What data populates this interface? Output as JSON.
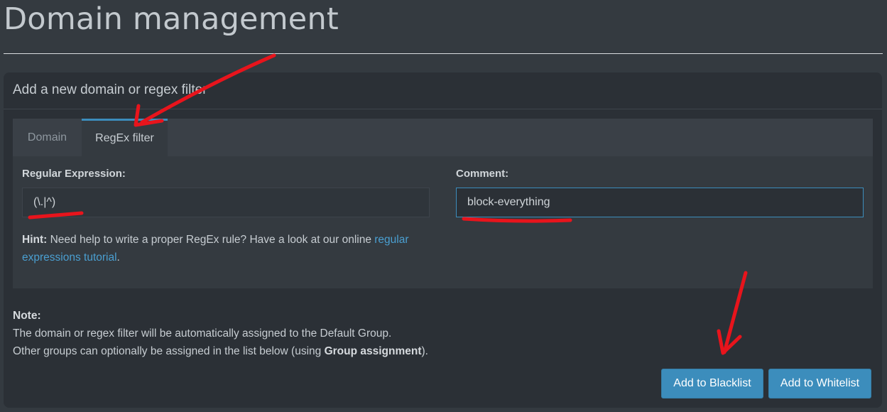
{
  "page": {
    "title": "Domain management"
  },
  "box": {
    "header": "Add a new domain or regex filter"
  },
  "tabs": [
    {
      "label": "Domain",
      "active": false
    },
    {
      "label": "RegEx filter",
      "active": true
    }
  ],
  "regex": {
    "label": "Regular Expression:",
    "value": "(\\.|^)"
  },
  "comment": {
    "label": "Comment:",
    "value": "block-everything"
  },
  "hint": {
    "bold": "Hint:",
    "text": " Need help to write a proper RegEx rule? Have a look at our online ",
    "link": "regular expressions tutorial",
    "end": "."
  },
  "note": {
    "bold": "Note:",
    "line1": "The domain or regex filter will be automatically assigned to the Default Group.",
    "line2_start": "Other groups can optionally be assigned in the list below (using ",
    "line2_bold": "Group assignment",
    "line2_end": ")."
  },
  "buttons": {
    "blacklist": "Add to Blacklist",
    "whitelist": "Add to Whitelist"
  },
  "colors": {
    "accent": "#3c8dbc",
    "annotation": "#e8141c",
    "background": "#343a40",
    "box": "#2b3036"
  }
}
